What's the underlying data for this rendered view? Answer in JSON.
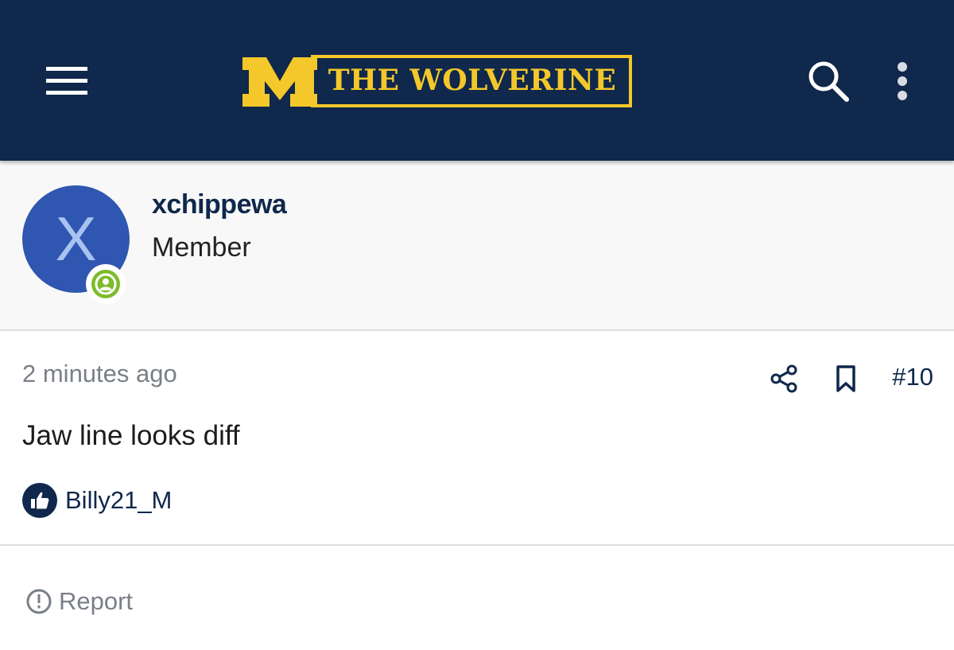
{
  "header": {
    "logo_text": "THE WOLVERINE",
    "colors": {
      "background": "#0f284b",
      "logo_maize": "#f4c82a"
    },
    "icons": {
      "menu": "hamburger-menu-icon",
      "search": "search-icon",
      "more": "vertical-ellipsis-icon"
    }
  },
  "author": {
    "avatar_letter": "X",
    "avatar_color": "#2f56b0",
    "username": "xchippewa",
    "title": "Member",
    "status_icon": "online-status-icon"
  },
  "post": {
    "timestamp": "2 minutes ago",
    "number": "#10",
    "body": "Jaw line looks diff",
    "actions": {
      "share": "share-icon",
      "bookmark": "bookmark-icon"
    },
    "reactions": {
      "icon": "thumbs-up-icon",
      "users": "Billy21_M"
    }
  },
  "footer": {
    "report_label": "Report",
    "report_icon": "alert-circle-icon"
  }
}
